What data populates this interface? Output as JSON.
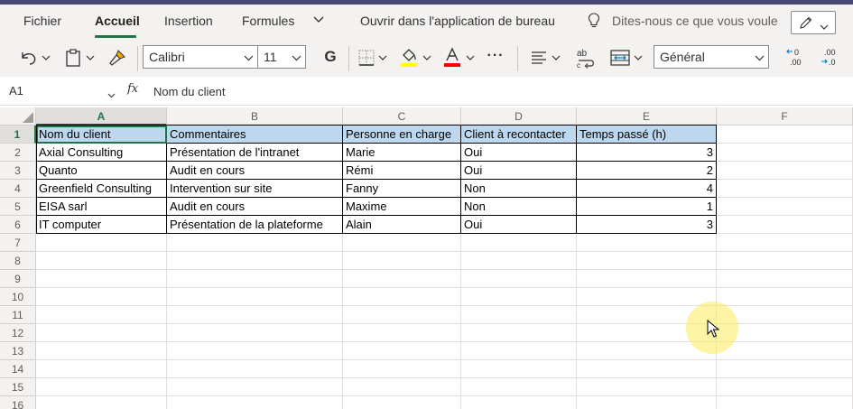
{
  "ribbon": {
    "tabs": [
      "Fichier",
      "Accueil",
      "Insertion",
      "Formules"
    ],
    "active_tab": "Accueil",
    "open_desktop": "Ouvrir dans l'application de bureau",
    "tell_me": "Dites-nous ce que vous voule",
    "icons": {
      "more_tabs": "chevron-down-icon",
      "tell_me": "lightbulb-icon",
      "edit_mode": "pencil-icon"
    },
    "accent_color": "#217346"
  },
  "toolbar": {
    "font_name": "Calibri",
    "font_size": "11",
    "bold_label": "G",
    "number_format": "Général",
    "more_label": "···",
    "decrease_decimal_label": ".00",
    "increase_decimal_label": ".0",
    "highlight_color": "#ffff00",
    "font_color": "#ff0000",
    "icons": [
      "undo-icon",
      "paste-icon",
      "format-painter-icon",
      "borders-icon",
      "fill-color-icon",
      "font-color-icon",
      "more-icon",
      "align-icon",
      "wrap-text-icon",
      "merge-icon",
      "decrease-decimal-icon",
      "increase-decimal-icon"
    ]
  },
  "formula_bar": {
    "name_box": "A1",
    "fx_label": "fx",
    "content": "Nom du client"
  },
  "sheet": {
    "columns": [
      "A",
      "B",
      "C",
      "D",
      "E",
      "F"
    ],
    "rows": [
      "1",
      "2",
      "3",
      "4",
      "5",
      "6",
      "7",
      "8",
      "9",
      "10",
      "11",
      "12",
      "13",
      "14",
      "15",
      "16"
    ],
    "headers": [
      "Nom du client",
      "Commentaires",
      "Personne en charge",
      "Client à recontacter",
      "Temps passé (h)"
    ],
    "data": [
      [
        "Axial Consulting",
        "Présentation de l'intranet",
        "Marie",
        "Oui",
        "3"
      ],
      [
        "Quanto",
        "Audit en cours",
        "Rémi",
        "Oui",
        "2"
      ],
      [
        "Greenfield Consulting",
        "Intervention sur site",
        "Fanny",
        "Non",
        "4"
      ],
      [
        "EISA sarl",
        "Audit en cours",
        "Maxime",
        "Non",
        "1"
      ],
      [
        "IT computer",
        "Présentation de la plateforme",
        "Alain",
        "Oui",
        "3"
      ]
    ],
    "header_fill": "#bdd7ee"
  }
}
